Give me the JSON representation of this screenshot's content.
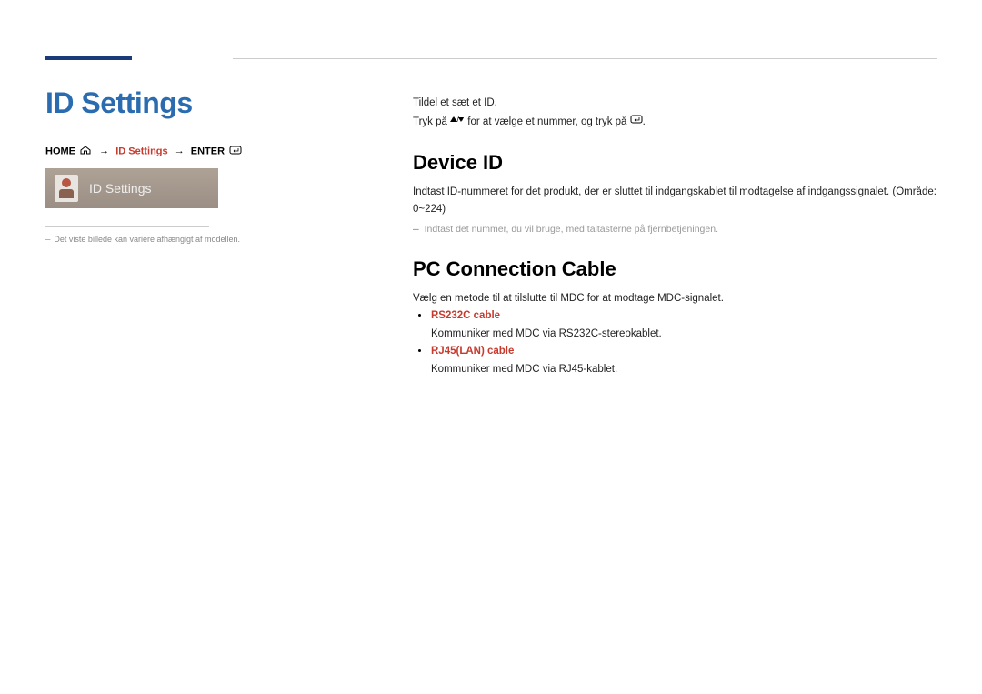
{
  "page_title": "ID Settings",
  "breadcrumb": {
    "home": "HOME",
    "sep": "→",
    "current": "ID Settings",
    "enter": "ENTER"
  },
  "screenshot_label": "ID Settings",
  "left_note": "Det viste billede kan variere afhængigt af modellen.",
  "intro": {
    "line1": "Tildel et sæt et ID.",
    "line2a": "Tryk på ",
    "line2b": " for at vælge et nummer, og tryk på ",
    "line2c": "."
  },
  "sections": [
    {
      "heading": "Device ID",
      "text": "Indtast ID-nummeret for det produkt, der er sluttet til indgangskablet til modtagelse af indgangssignalet. (Område: 0~224)",
      "note": "Indtast det nummer, du vil bruge, med taltasterne på fjernbetjeningen."
    },
    {
      "heading": "PC Connection Cable",
      "text": "Vælg en metode til at tilslutte til MDC for at modtage MDC-signalet.",
      "bullets": [
        {
          "title": "RS232C cable",
          "desc": "Kommuniker med MDC via RS232C-stereokablet."
        },
        {
          "title": "RJ45(LAN) cable",
          "desc": "Kommuniker med MDC via RJ45-kablet."
        }
      ]
    }
  ]
}
